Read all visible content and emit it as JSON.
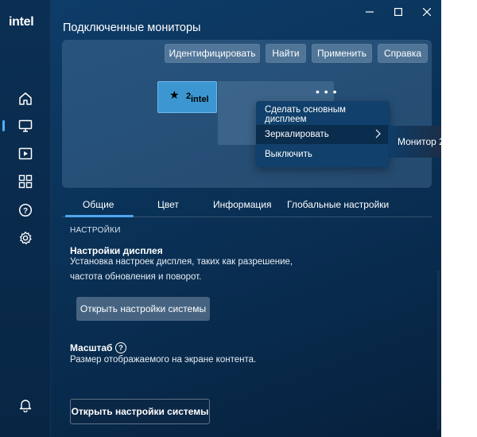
{
  "brand": {
    "logo_text": "intel"
  },
  "window": {
    "controls": [
      "minimize-icon",
      "maximize-icon",
      "close-icon"
    ]
  },
  "sidebar": {
    "items": [
      {
        "icon": "home-icon"
      },
      {
        "icon": "display-icon",
        "active": true
      },
      {
        "icon": "video-icon"
      },
      {
        "icon": "apps-grid-icon"
      },
      {
        "icon": "help-icon"
      },
      {
        "icon": "gear-icon"
      }
    ],
    "bottom_icon": "bell-icon"
  },
  "page": {
    "title": "Подключенные мониторы"
  },
  "toolbar": {
    "identify": "Идентифицировать",
    "find": "Найти",
    "apply": "Применить",
    "help": "Справка"
  },
  "monitors": {
    "primary": {
      "star": "★",
      "number": "2",
      "brand": "intel"
    },
    "more_dots": "• • •"
  },
  "context_menu": {
    "items": [
      "Сделать основным дисплеем",
      "Зеркалировать",
      "Выключить"
    ],
    "submenu": [
      "Монитор 2"
    ]
  },
  "tabs": [
    "Общие",
    "Цвет",
    "Информация",
    "Глобальные настройки"
  ],
  "settings": {
    "section_caption": "НАСТРОЙКИ",
    "display": {
      "heading": "Настройки дисплея",
      "line1": "Установка настроек дисплея, таких как разрешение,",
      "line2": "частота обновления и поворот.",
      "button": "Открыть настройки системы"
    },
    "scale": {
      "heading": "Масштаб",
      "help_glyph": "?",
      "description": "Размер отображаемого на экране контента.",
      "button": "Открыть настройки системы"
    }
  },
  "colors": {
    "accent": "#4fa6f0",
    "primary_monitor": "#3c96d2",
    "background": "#0a3359"
  }
}
